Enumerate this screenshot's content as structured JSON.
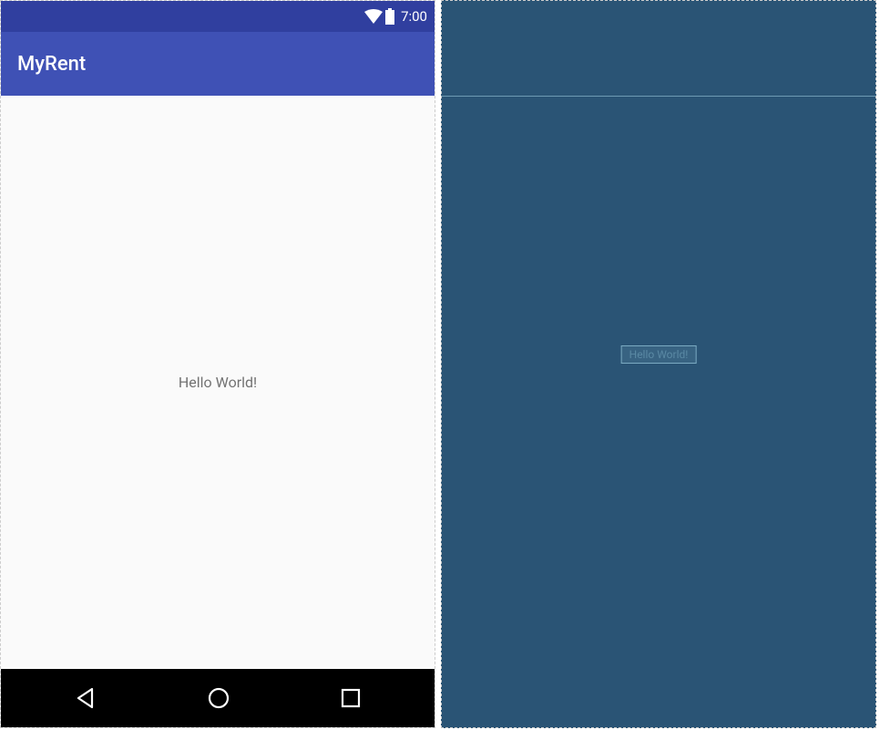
{
  "status_bar": {
    "time": "7:00"
  },
  "app_bar": {
    "title": "MyRent"
  },
  "content": {
    "hello": "Hello World!"
  },
  "blueprint": {
    "textview_label": "Hello World!"
  }
}
